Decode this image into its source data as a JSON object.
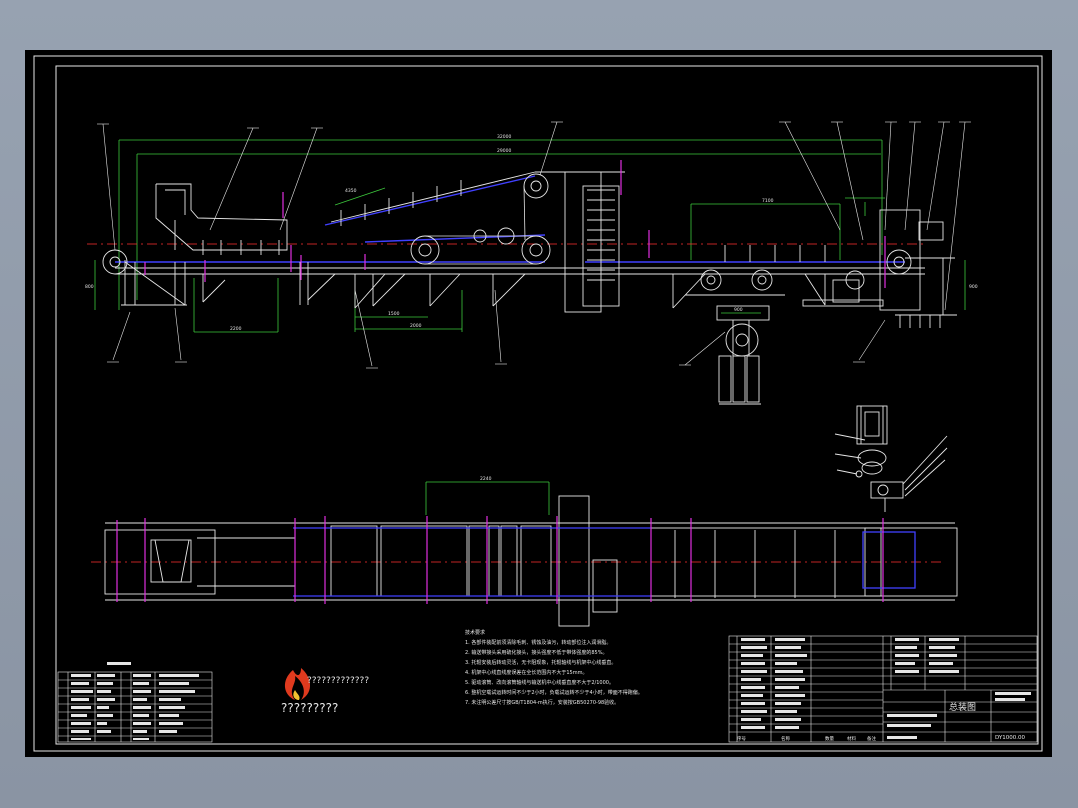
{
  "drawing": {
    "title_block": {
      "drawing_name": "总装图",
      "drawing_number": "DY1000.00",
      "header_labels": [
        "序号",
        "名称",
        "数量",
        "材料",
        "备注"
      ]
    },
    "dimensions": {
      "overall_length": "32000",
      "inner_length": "29000",
      "incline_section": "4350",
      "right_section": "7100",
      "left_span": "2200",
      "mid_span": "1500",
      "bridge_span": "2000",
      "motor_base": "900",
      "plan_span": "2240",
      "height_left": "800",
      "height_right": "900"
    },
    "tech_requirements": {
      "heading": "技术要求",
      "items": [
        "1. 各部件装配前须清除毛刺、锈蚀及油污，转动部位注入润滑脂。",
        "2. 输送带接头采用硫化接头，接头强度不低于带体强度的85%。",
        "3. 托辊安装后转动灵活，无卡阻现象，托辊轴线与机架中心线垂直。",
        "4. 机架中心线直线度误差在全长范围内不大于15mm。",
        "5. 驱动滚筒、改向滚筒轴线与输送机中心线垂直度不大于2/1000。",
        "6. 整机空载试运转时间不少于2小时，负载试运转不少于4小时，带面不得跑偏。",
        "7. 未注明公差尺寸按GB/T1804-m执行，安装按GB50270-98验收。"
      ]
    },
    "logo_text": "?????????",
    "logo_subtext": "?????????????"
  }
}
